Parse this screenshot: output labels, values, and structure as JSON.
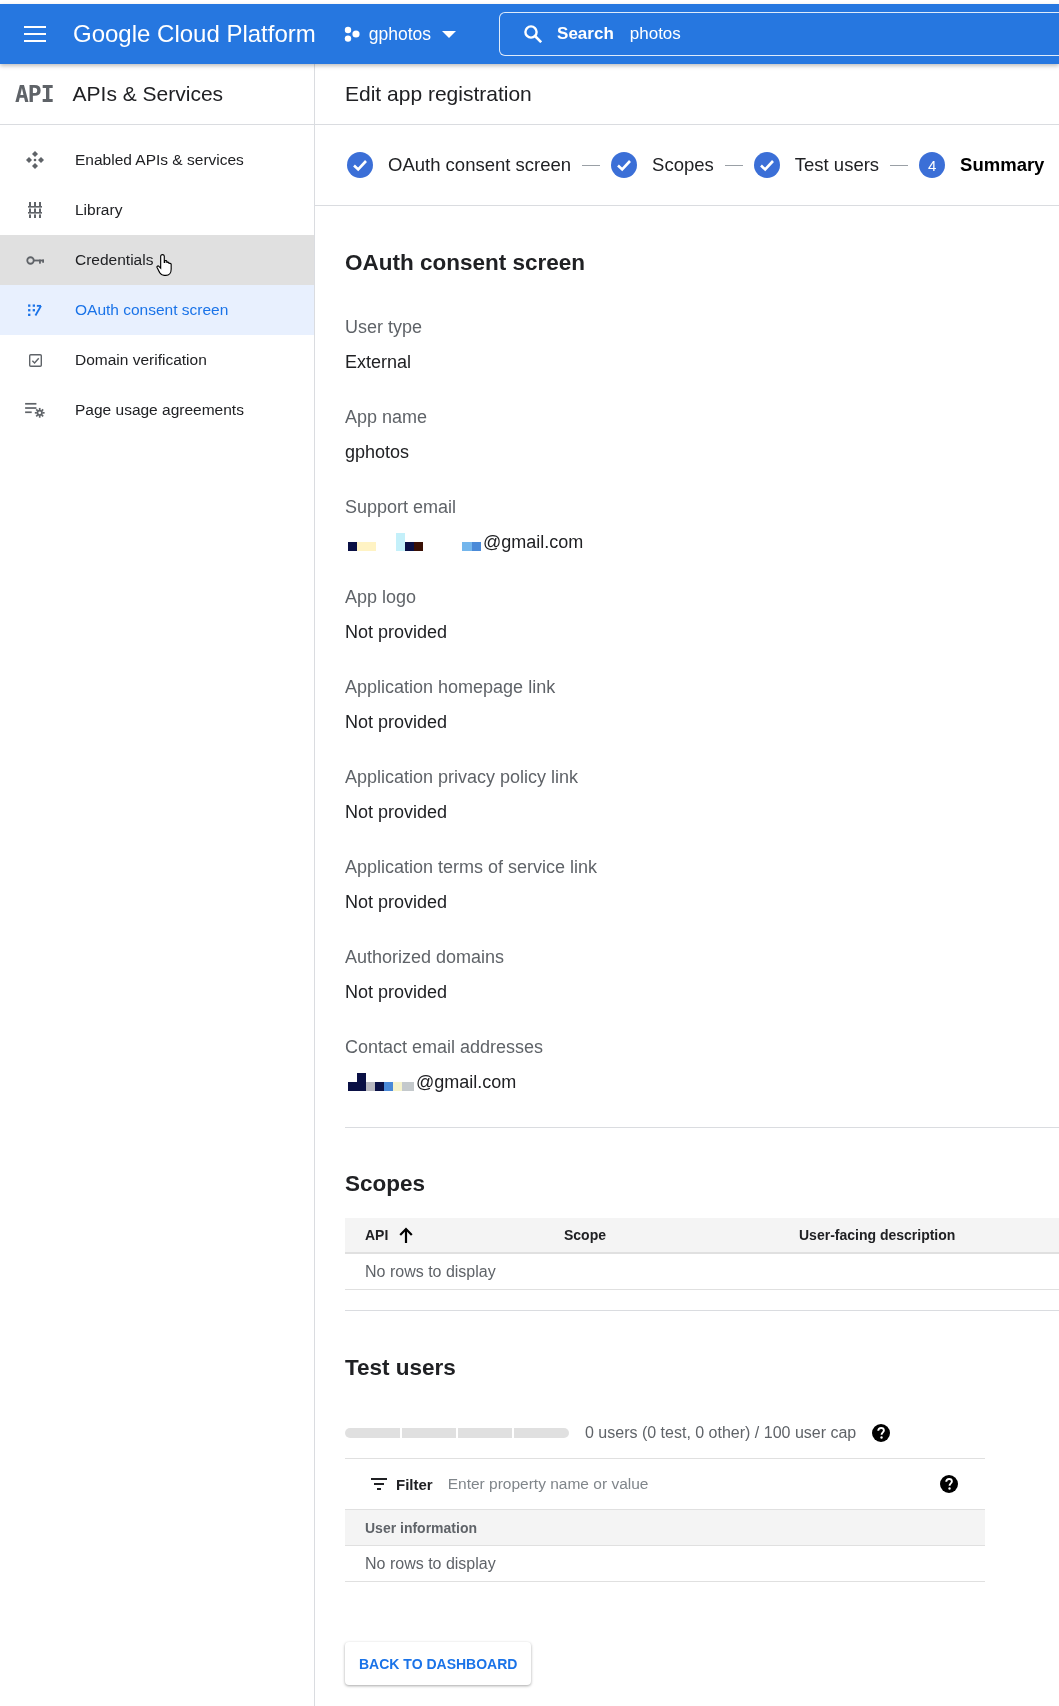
{
  "top_bar": {
    "product_name": "Google Cloud Platform",
    "project": "gphotos",
    "search": {
      "label": "Search",
      "value": "photos"
    }
  },
  "sidebar": {
    "logo": "API",
    "title": "APIs & Services",
    "items": [
      {
        "label": "Enabled APIs & services",
        "selected": false,
        "hovered": false
      },
      {
        "label": "Library",
        "selected": false,
        "hovered": false
      },
      {
        "label": "Credentials",
        "selected": false,
        "hovered": true
      },
      {
        "label": "OAuth consent screen",
        "selected": true,
        "hovered": false
      },
      {
        "label": "Domain verification",
        "selected": false,
        "hovered": false
      },
      {
        "label": "Page usage agreements",
        "selected": false,
        "hovered": false
      }
    ]
  },
  "page_title": "Edit app registration",
  "stepper": {
    "steps": [
      {
        "label": "OAuth consent screen",
        "done": true,
        "selected": false
      },
      {
        "label": "Scopes",
        "done": true,
        "selected": false
      },
      {
        "label": "Test users",
        "done": true,
        "selected": false
      },
      {
        "label": "Summary",
        "number": "4",
        "done": false,
        "selected": true
      }
    ]
  },
  "summary": {
    "title": "OAuth consent screen",
    "fields": [
      {
        "label": "User type",
        "value": "External",
        "kind": "text"
      },
      {
        "label": "App name",
        "value": "gphotos",
        "kind": "text"
      },
      {
        "label": "Support email",
        "value": "@gmail.com",
        "kind": "redacted"
      },
      {
        "label": "App logo",
        "value": "Not provided",
        "kind": "text"
      },
      {
        "label": "Application homepage link",
        "value": "Not provided",
        "kind": "text"
      },
      {
        "label": "Application privacy policy link",
        "value": "Not provided",
        "kind": "text"
      },
      {
        "label": "Application terms of service link",
        "value": "Not provided",
        "kind": "text"
      },
      {
        "label": "Authorized domains",
        "value": "Not provided",
        "kind": "text"
      },
      {
        "label": "Contact email addresses",
        "value": "@gmail.com",
        "kind": "redacted"
      }
    ]
  },
  "scopes": {
    "title": "Scopes",
    "columns": [
      {
        "label": "API",
        "sorted": true
      },
      {
        "label": "Scope",
        "sorted": false
      },
      {
        "label": "User-facing description",
        "sorted": false
      }
    ],
    "empty_message": "No rows to display"
  },
  "test_users": {
    "title": "Test users",
    "usage": {
      "level": 0,
      "text": "0 users (0 test, 0 other) / 100 user cap"
    },
    "filter": {
      "label": "Filter",
      "placeholder": "Enter property name or value"
    },
    "columns": [
      {
        "label": "User information"
      }
    ],
    "empty_message": "No rows to display"
  },
  "back_button": "BACK TO DASHBOARD"
}
